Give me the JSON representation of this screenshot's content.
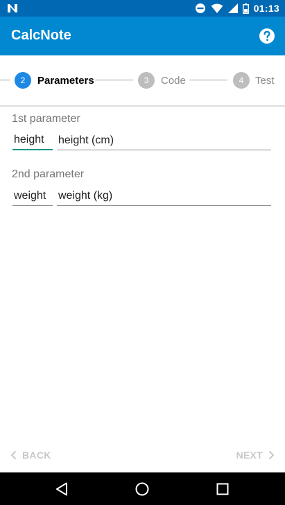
{
  "status_bar": {
    "time": "01:13",
    "icons": [
      "notification-n-icon",
      "do-not-disturb-icon",
      "wifi-icon",
      "cell-signal-icon",
      "battery-icon"
    ]
  },
  "app_bar": {
    "title": "CalcNote",
    "help_icon": "help-icon"
  },
  "stepper": {
    "steps": [
      {
        "number": "2",
        "label": "Parameters",
        "active": true
      },
      {
        "number": "3",
        "label": "Code",
        "active": false
      },
      {
        "number": "4",
        "label": "Test",
        "active": false
      }
    ]
  },
  "parameters": [
    {
      "heading": "1st parameter",
      "name": "height",
      "description": "height (cm)"
    },
    {
      "heading": "2nd parameter",
      "name": "weight",
      "description": "weight (kg)"
    }
  ],
  "bottom_nav": {
    "back_label": "BACK",
    "next_label": "NEXT"
  },
  "system_nav": {
    "icons": [
      "back-triangle-icon",
      "home-circle-icon",
      "recents-square-icon"
    ]
  },
  "colors": {
    "status_bar": "#0069b4",
    "app_bar": "#0288d1",
    "active_step": "#1e88e5",
    "inactive_step": "#bdbdbd",
    "focus_underline": "#009688"
  }
}
